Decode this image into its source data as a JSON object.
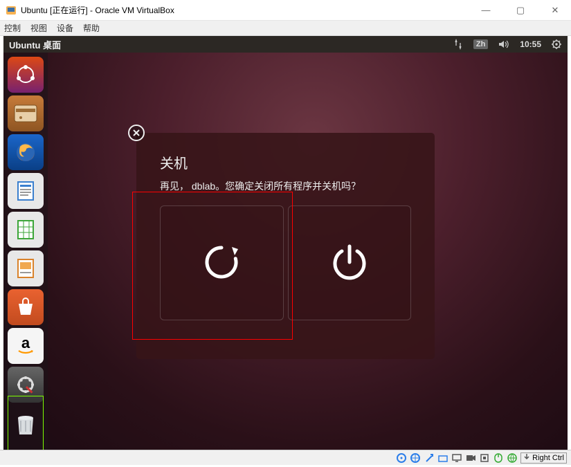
{
  "virtualbox": {
    "title": "Ubuntu [正在运行] - Oracle VM VirtualBox",
    "window_controls": {
      "min": "—",
      "max": "▢",
      "close": "✕"
    },
    "menu": {
      "control": "控制",
      "view": "视图",
      "device": "设备",
      "help": "帮助"
    },
    "host_key": "Right Ctrl"
  },
  "ubuntu": {
    "topbar": {
      "title": "Ubuntu 桌面"
    },
    "indicators": {
      "ime": "Zh",
      "time": "10:55"
    },
    "launcher": [
      {
        "name": "dash"
      },
      {
        "name": "files"
      },
      {
        "name": "firefox"
      },
      {
        "name": "writer"
      },
      {
        "name": "calc"
      },
      {
        "name": "impress"
      },
      {
        "name": "software"
      },
      {
        "name": "amazon"
      },
      {
        "name": "settings"
      },
      {
        "name": "trash"
      }
    ],
    "shutdown_dialog": {
      "title": "关机",
      "message": "再见， dblab。您确定关闭所有程序并关机吗？",
      "options": {
        "restart": "restart",
        "shutdown": "shutdown"
      }
    }
  }
}
